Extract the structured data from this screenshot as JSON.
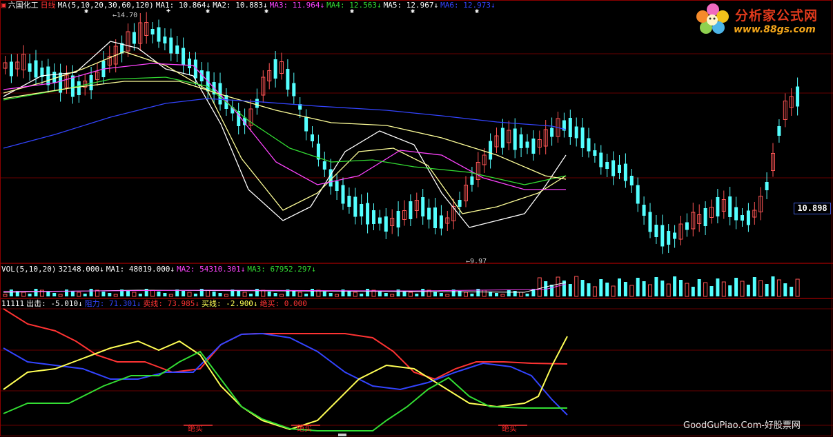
{
  "main_header": {
    "symbol_icon": "ticker-flag-icon",
    "stock_name": "六国化工",
    "period": "日线",
    "ma_params": "MA(5,10,20,30,60,120)",
    "items": [
      {
        "label": "MA1: 10.864↓",
        "color": "#ffffff"
      },
      {
        "label": "MA2: 10.883↓",
        "color": "#ffffff"
      },
      {
        "label": "MA3: 11.964↓",
        "color": "#ff44ff"
      },
      {
        "label": "MA4: 12.563↓",
        "color": "#33dd33"
      },
      {
        "label": "MA5: 12.967↓",
        "color": "#ffffff"
      },
      {
        "label": "MA6: 12.973↓",
        "color": "#3344ff"
      }
    ]
  },
  "price_labels": {
    "high": "14.70",
    "low": "9.97",
    "current": "10.898"
  },
  "vol_header": {
    "label": "VOL(5,10,20)",
    "value": "32148.000↓",
    "items": [
      {
        "label": "MA1: 48019.000↓",
        "color": "#ffffff"
      },
      {
        "label": "MA2: 54310.301↓",
        "color": "#ff44ff"
      },
      {
        "label": "MA3: 67952.297↓",
        "color": "#33dd33"
      }
    ]
  },
  "ind_header": {
    "label": "11111",
    "items": [
      {
        "label": "出击: -5.010↓",
        "color": "#ffffff"
      },
      {
        "label": "阻力: 71.301↓",
        "color": "#3344ff"
      },
      {
        "label": "卖线: 73.985↓",
        "color": "#ff3333"
      },
      {
        "label": "买线: -2.900↓",
        "color": "#ffff55"
      },
      {
        "label": "绝买: 0.000",
        "color": "#ff3333"
      }
    ]
  },
  "signals": [
    "绝买",
    "绝买",
    "绝买"
  ],
  "logo": {
    "title": "分析家公式网",
    "url": "www.88gs.com",
    "icon": "flower-logo-icon"
  },
  "watermark": "GoodGuPiao.Com-好股票网",
  "colors": {
    "up": "#ff5555",
    "down": "#54ffff",
    "grid": "#8b0000",
    "ma1": "#ffffff",
    "ma2": "#ffff99",
    "ma3": "#ff44ff",
    "ma4": "#33dd33",
    "ma6": "#3344ff",
    "chuji": "#ffffff",
    "zuli": "#3344ff",
    "maixian_sell": "#ff3333",
    "maixian_buy": "#ffff55",
    "green": "#33dd33"
  }
}
